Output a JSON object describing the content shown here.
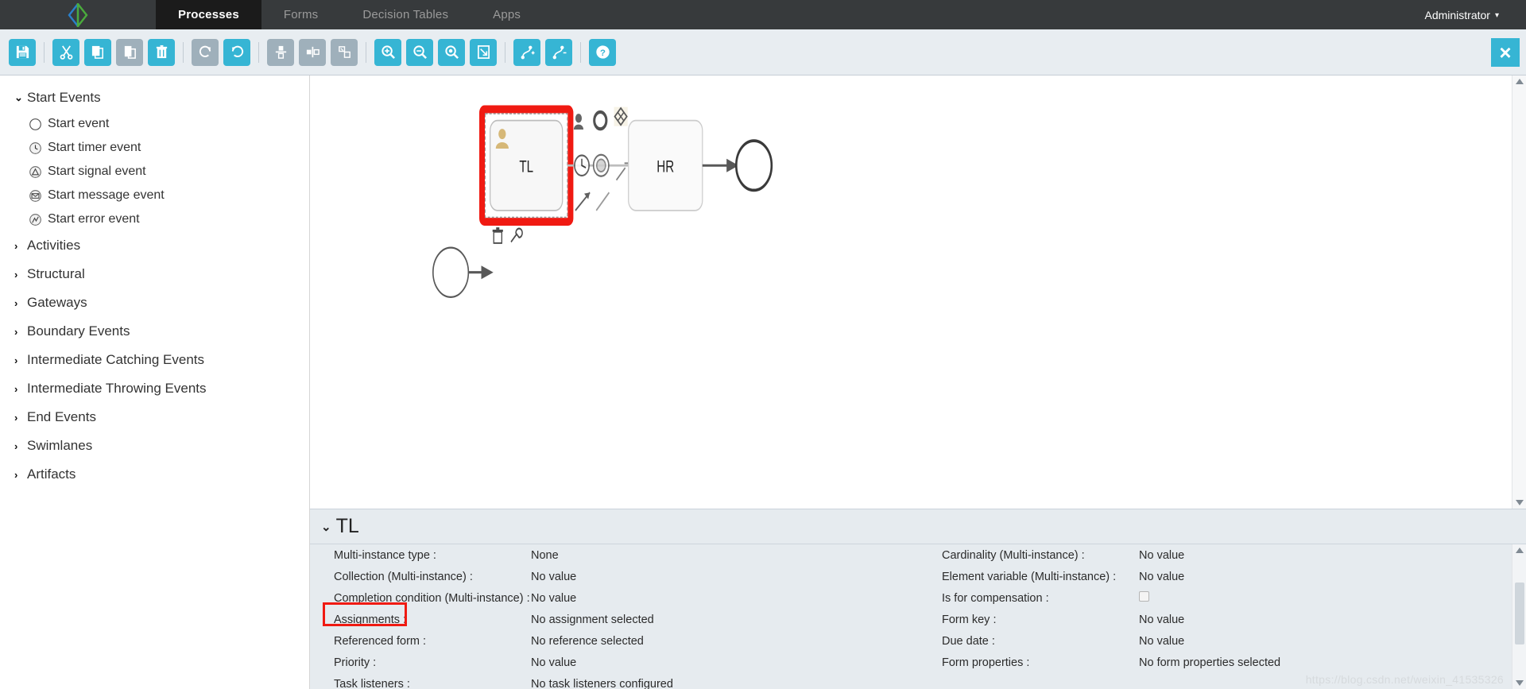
{
  "topnav": {
    "brand_icon": "diamond-logo-icon",
    "tabs": [
      {
        "label": "Processes",
        "active": true
      },
      {
        "label": "Forms",
        "active": false
      },
      {
        "label": "Decision Tables",
        "active": false
      },
      {
        "label": "Apps",
        "active": false
      }
    ],
    "user": "Administrator",
    "user_caret": "▾"
  },
  "toolbar": {
    "buttons": [
      {
        "name": "save-button",
        "icon": "save-icon",
        "state": "enabled",
        "title": "Save"
      },
      {
        "sep": true
      },
      {
        "name": "cut-button",
        "icon": "scissors-icon",
        "state": "enabled",
        "title": "Cut"
      },
      {
        "name": "copy-button",
        "icon": "copy-icon",
        "state": "enabled",
        "title": "Copy"
      },
      {
        "name": "paste-button",
        "icon": "paste-icon",
        "state": "disabled",
        "title": "Paste"
      },
      {
        "name": "delete-button",
        "icon": "trash-icon",
        "state": "enabled",
        "title": "Delete"
      },
      {
        "sep": true
      },
      {
        "name": "redo-button",
        "icon": "redo-icon",
        "state": "disabled",
        "title": "Redo"
      },
      {
        "name": "undo-button",
        "icon": "undo-icon",
        "state": "enabled",
        "title": "Undo"
      },
      {
        "sep": true
      },
      {
        "name": "align-vertical-button",
        "icon": "align-vertical-icon",
        "state": "disabled",
        "title": "Align vertical"
      },
      {
        "name": "align-horizontal-button",
        "icon": "align-horizontal-icon",
        "state": "disabled",
        "title": "Align horizontal"
      },
      {
        "name": "same-size-button",
        "icon": "same-size-icon",
        "state": "disabled",
        "title": "Same size"
      },
      {
        "sep": true
      },
      {
        "name": "zoom-in-button",
        "icon": "zoom-in-icon",
        "state": "enabled",
        "title": "Zoom in"
      },
      {
        "name": "zoom-out-button",
        "icon": "zoom-out-icon",
        "state": "enabled",
        "title": "Zoom out"
      },
      {
        "name": "zoom-actual-button",
        "icon": "zoom-actual-icon",
        "state": "enabled",
        "title": "Zoom actual"
      },
      {
        "name": "zoom-fit-button",
        "icon": "zoom-fit-icon",
        "state": "enabled",
        "title": "Zoom fit"
      },
      {
        "sep": true
      },
      {
        "name": "add-bendpoint-button",
        "icon": "add-bendpoint-icon",
        "state": "enabled",
        "title": "Add bendpoint"
      },
      {
        "name": "remove-bendpoint-button",
        "icon": "remove-bendpoint-icon",
        "state": "enabled",
        "title": "Remove bendpoint"
      },
      {
        "sep": true
      },
      {
        "name": "help-button",
        "icon": "question-mark-icon",
        "state": "enabled",
        "title": "Help"
      }
    ],
    "close_label": "×",
    "accent_color": "#36b5d4",
    "disabled_color": "#9fb0bb"
  },
  "palette": {
    "groups": [
      {
        "label": "Start Events",
        "expanded": true,
        "items": [
          {
            "label": "Start event",
            "icon": "circle-icon"
          },
          {
            "label": "Start timer event",
            "icon": "timer-icon"
          },
          {
            "label": "Start signal event",
            "icon": "signal-triangle-icon"
          },
          {
            "label": "Start message event",
            "icon": "envelope-icon"
          },
          {
            "label": "Start error event",
            "icon": "error-bolt-icon"
          }
        ]
      },
      {
        "label": "Activities",
        "expanded": false,
        "items": []
      },
      {
        "label": "Structural",
        "expanded": false,
        "items": []
      },
      {
        "label": "Gateways",
        "expanded": false,
        "items": []
      },
      {
        "label": "Boundary Events",
        "expanded": false,
        "items": []
      },
      {
        "label": "Intermediate Catching Events",
        "expanded": false,
        "items": []
      },
      {
        "label": "Intermediate Throwing Events",
        "expanded": false,
        "items": []
      },
      {
        "label": "End Events",
        "expanded": false,
        "items": []
      },
      {
        "label": "Swimlanes",
        "expanded": false,
        "items": []
      },
      {
        "label": "Artifacts",
        "expanded": false,
        "items": []
      }
    ],
    "expanded_chevron": "⌄",
    "collapsed_chevron": "›"
  },
  "diagram": {
    "start_event": {
      "name": "start-event-node",
      "label": ""
    },
    "task_selected": {
      "label": "TL",
      "type": "user-task",
      "selected": true
    },
    "task_second": {
      "label": "HR",
      "type": "user-task",
      "selected": false
    },
    "end_event": {
      "name": "end-event-node",
      "label": ""
    },
    "selection_color": "#f01a12",
    "quick_menu": [
      {
        "name": "quick-user-task-icon",
        "icon": "person-icon"
      },
      {
        "name": "quick-event-icon",
        "icon": "circle-outline-icon"
      },
      {
        "name": "quick-gateway-icon",
        "icon": "diamond-icon"
      },
      {
        "name": "quick-timer-icon",
        "icon": "timer-icon"
      },
      {
        "name": "quick-end-event-icon",
        "icon": "thick-circle-icon"
      },
      {
        "name": "quick-sequence-flow-icon",
        "icon": "arrow-diagonal-icon"
      },
      {
        "name": "quick-association-icon",
        "icon": "line-diagonal-icon"
      },
      {
        "name": "quick-boundary-icon",
        "icon": "wrench-small-icon"
      }
    ],
    "context_tools": [
      {
        "name": "delete-shape-icon",
        "icon": "trash-icon"
      },
      {
        "name": "edit-shape-icon",
        "icon": "wrench-icon"
      }
    ]
  },
  "properties": {
    "title": "TL",
    "expanded_chevron": "⌄",
    "left_rows": [
      {
        "label": "Multi-instance type :",
        "value": "None",
        "type": "text"
      },
      {
        "label": "Collection (Multi-instance) :",
        "value": "No value",
        "type": "text"
      },
      {
        "label": "Completion condition (Multi-instance) :",
        "value": "No value",
        "type": "text"
      },
      {
        "label": "Assignments :",
        "value": "No assignment selected",
        "type": "text",
        "highlighted": true
      },
      {
        "label": "Referenced form :",
        "value": "No reference selected",
        "type": "text"
      },
      {
        "label": "Priority :",
        "value": "No value",
        "type": "text"
      },
      {
        "label": "Task listeners :",
        "value": "No task listeners configured",
        "type": "text"
      }
    ],
    "right_rows": [
      {
        "label": "Cardinality (Multi-instance) :",
        "value": "No value",
        "type": "text"
      },
      {
        "label": "Element variable (Multi-instance) :",
        "value": "No value",
        "type": "text"
      },
      {
        "label": "Is for compensation :",
        "value": "",
        "type": "checkbox",
        "checked": false
      },
      {
        "label": "Form key :",
        "value": "No value",
        "type": "text"
      },
      {
        "label": "Due date :",
        "value": "No value",
        "type": "text"
      },
      {
        "label": "Form properties :",
        "value": "No form properties selected",
        "type": "text"
      }
    ]
  },
  "watermark": "https://blog.csdn.net/weixin_41535326"
}
